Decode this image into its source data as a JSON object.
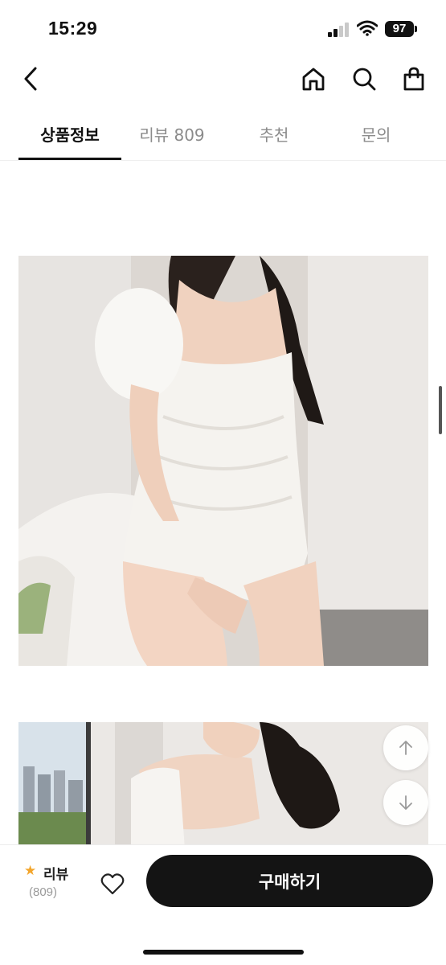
{
  "status_bar": {
    "time": "15:29",
    "battery": "97",
    "icons": [
      "signal-icon",
      "wifi-icon",
      "battery-icon"
    ]
  },
  "nav": {
    "icons": [
      "back-icon",
      "home-icon",
      "search-icon",
      "shopping-bag-icon"
    ]
  },
  "tabs": [
    {
      "label": "상품정보",
      "active": true
    },
    {
      "label": "리뷰 809",
      "active": false
    },
    {
      "label": "추천",
      "active": false
    },
    {
      "label": "문의",
      "active": false
    }
  ],
  "content": {
    "images": [
      "product-photo-front",
      "product-photo-back"
    ],
    "float_buttons": [
      "scroll-up-icon",
      "scroll-down-icon"
    ]
  },
  "bottom_bar": {
    "review_label": "리뷰",
    "review_count": "(809)",
    "buy_label": "구매하기",
    "icons": [
      "star-icon",
      "heart-icon"
    ]
  },
  "colors": {
    "accent_star": "#f3a52b",
    "buy_button": "#141414",
    "tab_inactive": "#8b8b8b"
  }
}
